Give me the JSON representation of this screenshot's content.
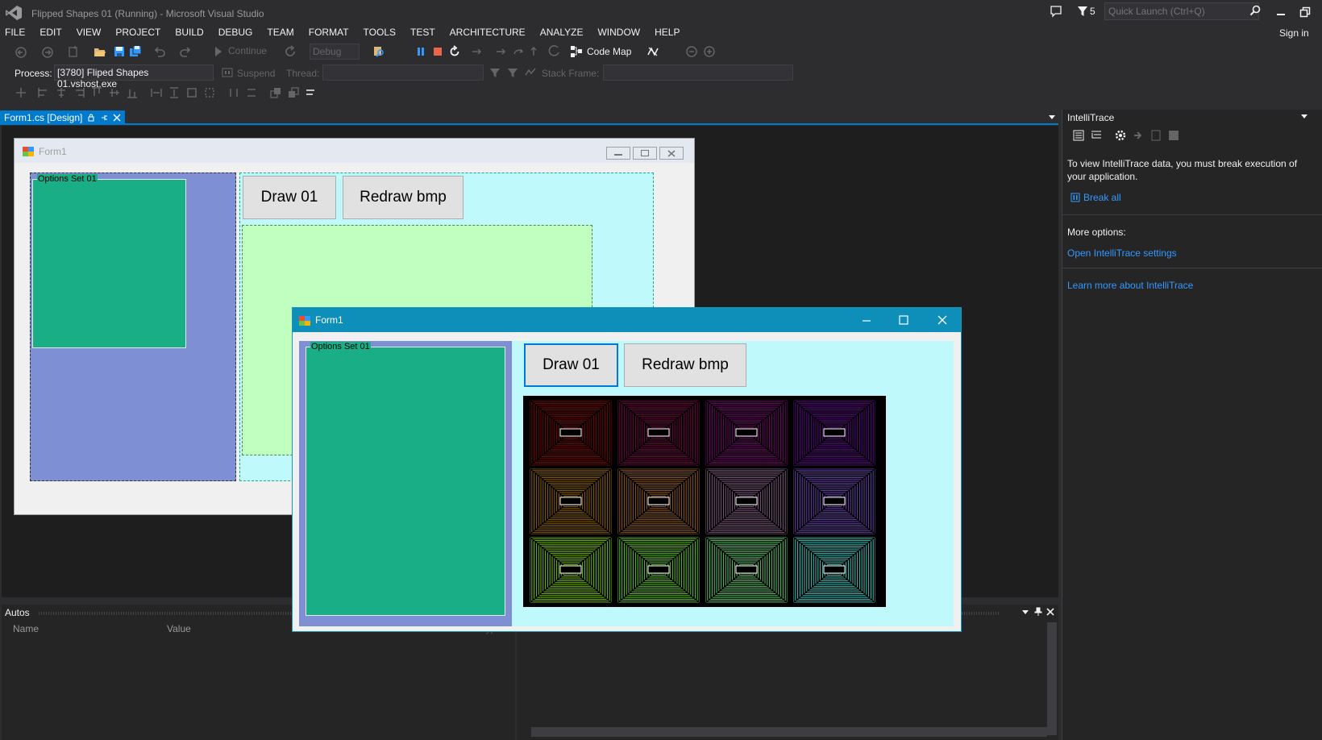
{
  "window": {
    "title": "Flipped Shapes 01 (Running) - Microsoft Visual Studio",
    "filter_count": "5",
    "quick_launch_placeholder": "Quick Launch (Ctrl+Q)",
    "sign_in": "Sign in"
  },
  "menu": [
    "FILE",
    "EDIT",
    "VIEW",
    "PROJECT",
    "BUILD",
    "DEBUG",
    "TEAM",
    "FORMAT",
    "TOOLS",
    "TEST",
    "ARCHITECTURE",
    "ANALYZE",
    "WINDOW",
    "HELP"
  ],
  "toolbar": {
    "continue_label": "Continue",
    "config": "Debug",
    "code_map_label": "Code Map"
  },
  "debug_location": {
    "process_label": "Process:",
    "process_value": "[3780] Fliped Shapes 01.vshost.exe",
    "suspend_label": "Suspend",
    "thread_label": "Thread:",
    "stack_frame_label": "Stack Frame:"
  },
  "doc_tab": {
    "label": "Form1.cs [Design]"
  },
  "design_form": {
    "title": "Form1",
    "group_label": "Options Set 01",
    "button1": "Draw 01",
    "button2": "Redraw bmp"
  },
  "running_form": {
    "title": "Form1",
    "group_label": "Options Set 01",
    "button1": "Draw 01",
    "button2": "Redraw bmp",
    "tile_colors": [
      [
        "#c81010",
        "#c0106a",
        "#c010b0",
        "#9a10e0"
      ],
      [
        "#c88a10",
        "#c88040",
        "#b080b0",
        "#9060e8"
      ],
      [
        "#8ae010",
        "#70e040",
        "#70e080",
        "#50e0d8"
      ]
    ]
  },
  "intellitrace": {
    "title": "IntelliTrace",
    "message": "To view IntelliTrace data, you must break execution of your application.",
    "break_all": "Break all",
    "more_options": "More options:",
    "open_settings": "Open IntelliTrace settings",
    "learn_more": "Learn more about IntelliTrace"
  },
  "autos": {
    "title": "Autos",
    "columns": [
      "Name",
      "Value",
      "Type"
    ]
  },
  "colors": {
    "accent": "#007acc",
    "background": "#2d2d30",
    "link": "#3399ff"
  }
}
